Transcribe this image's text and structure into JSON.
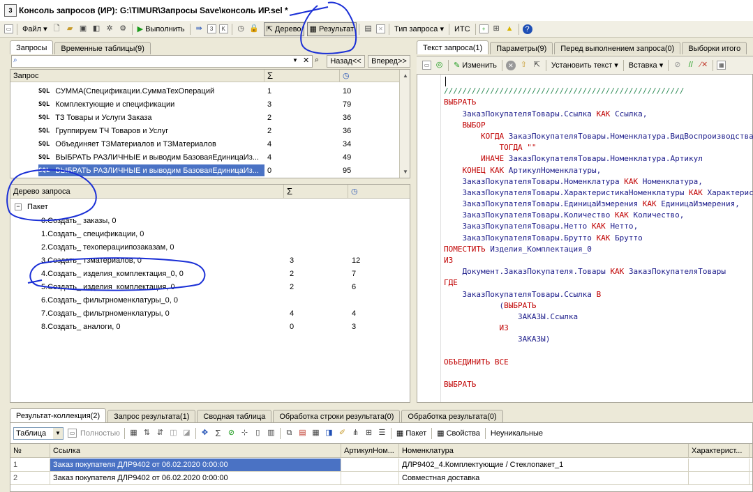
{
  "window": {
    "title": "Консоль запросов (ИР): G:\\TIMUR\\Запросы Save\\консоль ИР.sel *",
    "app_icon": "3"
  },
  "toolbar": {
    "file": "Файл",
    "run": "Выполнить",
    "tree": "Дерево",
    "result": "Результат",
    "query_type": "Тип запроса",
    "its": "ИТС"
  },
  "left_tabs": [
    "Запросы",
    "Временные таблицы(9)"
  ],
  "search": {
    "back": "Назад<<",
    "forward": "Вперед>>"
  },
  "query_list": {
    "header": {
      "name": "Запрос",
      "sum_icon": "Σ",
      "time_icon": "clock-icon"
    },
    "rows": [
      {
        "tag": "SQL",
        "name": "СУММА(Спецификации.СуммаТехОпераций",
        "count": "1",
        "time": "10"
      },
      {
        "tag": "SQL",
        "name": "Комплектующие и спецификации",
        "count": "3",
        "time": "79"
      },
      {
        "tag": "SQL",
        "name": "ТЗ Товары и Услуги Заказа",
        "count": "2",
        "time": "36"
      },
      {
        "tag": "SQL",
        "name": "Группируем ТЧ Товаров и Услуг",
        "count": "2",
        "time": "36"
      },
      {
        "tag": "SQL",
        "name": "Объединяет ТЗМатериалов и ТЗМатериалов",
        "count": "4",
        "time": "34"
      },
      {
        "tag": "SQL",
        "name": "ВЫБРАТЬ РАЗЛИЧНЫЕ и выводим БазоваяЕдиницаИз...",
        "count": "4",
        "time": "49"
      },
      {
        "tag": "SQL",
        "name": "ВЫБРАТЬ РАЗЛИЧНЫЕ и выводим БазоваяЕдиницаИз...",
        "count": "0",
        "time": "95"
      }
    ]
  },
  "query_tree": {
    "header": {
      "name": "Дерево запроса",
      "sum_icon": "Σ"
    },
    "root": "Пакет",
    "rows": [
      {
        "name": "0.Создать_ заказы, 0",
        "count": "",
        "time": ""
      },
      {
        "name": "1.Создать_ спецификации, 0",
        "count": "",
        "time": ""
      },
      {
        "name": "2.Создать_ техоперациипозаказам, 0",
        "count": "",
        "time": ""
      },
      {
        "name": "3.Создать_ тзматериалов, 0",
        "count": "3",
        "time": "12"
      },
      {
        "name": "4.Создать_ изделия_комплектация_0, 0",
        "count": "2",
        "time": "7"
      },
      {
        "name": "5.Создать_ изделия_комплектация, 0",
        "count": "2",
        "time": "6"
      },
      {
        "name": "6.Создать_ фильтрноменклатуры_0, 0",
        "count": "",
        "time": ""
      },
      {
        "name": "7.Создать_ фильтрноменклатуры, 0",
        "count": "4",
        "time": "4"
      },
      {
        "name": "8.Создать_ аналоги, 0",
        "count": "0",
        "time": "3"
      }
    ]
  },
  "right_tabs": [
    "Текст запроса(1)",
    "Параметры(9)",
    "Перед выполнением запроса(0)",
    "Выборки итого"
  ],
  "editor_toolbar": {
    "change": "Изменить",
    "set_text": "Установить текст",
    "insert": "Вставка"
  },
  "code_lines": [
    "",
    "////////////////////////////////////////////////////",
    "ВЫБРАТЬ",
    "    ЗаказПокупателяТовары.Ссылка КАК Ссылка,",
    "    ВЫБОР",
    "        КОГДА ЗаказПокупателяТовары.Номенклатура.ВидВоспроизводства",
    "            ТОГДА \"\"",
    "        ИНАЧЕ ЗаказПокупателяТовары.Номенклатура.Артикул",
    "    КОНЕЦ КАК АртикулНоменклатуры,",
    "    ЗаказПокупателяТовары.Номенклатура КАК Номенклатура,",
    "    ЗаказПокупателяТовары.ХарактеристикаНоменклатуры КАК Характеристика,",
    "    ЗаказПокупателяТовары.ЕдиницаИзмерения КАК ЕдиницаИзмерения,",
    "    ЗаказПокупателяТовары.Количество КАК Количество,",
    "    ЗаказПокупателяТовары.Нетто КАК Нетто,",
    "    ЗаказПокупателяТовары.Брутто КАК Брутто",
    "ПОМЕСТИТЬ Изделия_Комплектация_0",
    "ИЗ",
    "    Документ.ЗаказПокупателя.Товары КАК ЗаказПокупателяТовары",
    "ГДЕ",
    "    ЗаказПокупателяТовары.Ссылка В",
    "            (ВЫБРАТЬ",
    "                ЗАКАЗЫ.Ссылка",
    "            ИЗ",
    "                ЗАКАЗЫ)",
    "",
    "ОБЪЕДИНИТЬ ВСЕ",
    "",
    "ВЫБРАТЬ"
  ],
  "bottom_tabs": [
    "Результат-коллекция(2)",
    "Запрос результата(1)",
    "Сводная таблица",
    "Обработка строки результата(0)",
    "Обработка результата(0)"
  ],
  "bottom_toolbar": {
    "view_select": "Таблица",
    "fullness": "Полностью",
    "packet": "Пакет",
    "properties": "Свойства",
    "non_unique": "Неуникальные"
  },
  "result_table": {
    "columns": [
      "№",
      "Ссылка",
      "АртикулНом...",
      "Номенклатура",
      "Характерист...",
      "Е"
    ],
    "rows": [
      [
        "1",
        "Заказ покупателя ДЛР9402 от 06.02.2020 0:00:00",
        "",
        "ДЛР9402_4.Комплектующие / Стеклопакет_1",
        "",
        "ш"
      ],
      [
        "2",
        "Заказ покупателя ДЛР9402 от 06.02.2020 0:00:00",
        "",
        "Совместная доставка",
        "",
        ""
      ]
    ]
  },
  "colors": {
    "selection": "#4A72C4",
    "annotation": "#1a2fd6",
    "keyword": "#c00000"
  }
}
